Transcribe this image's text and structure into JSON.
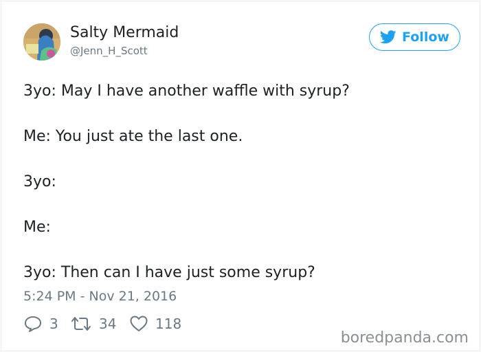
{
  "author": {
    "name": "Salty Mermaid",
    "handle": "@Jenn_H_Scott"
  },
  "follow_button": {
    "label": "Follow"
  },
  "tweet": {
    "lines": [
      "3yo: May I have another waffle with syrup?",
      "Me: You just ate the last one.",
      "3yo:",
      "Me:",
      "3yo: Then can I have just some syrup?"
    ],
    "timestamp": "5:24 PM - Nov 21, 2016"
  },
  "actions": {
    "replies": "3",
    "retweets": "34",
    "likes": "118"
  },
  "watermark": "boredpanda.com",
  "colors": {
    "accent": "#1da1f2",
    "text": "#1c2022",
    "muted": "#697882",
    "border": "#e6ecf0"
  },
  "icons": [
    "twitter-bird-icon",
    "reply-icon",
    "retweet-icon",
    "like-icon"
  ]
}
